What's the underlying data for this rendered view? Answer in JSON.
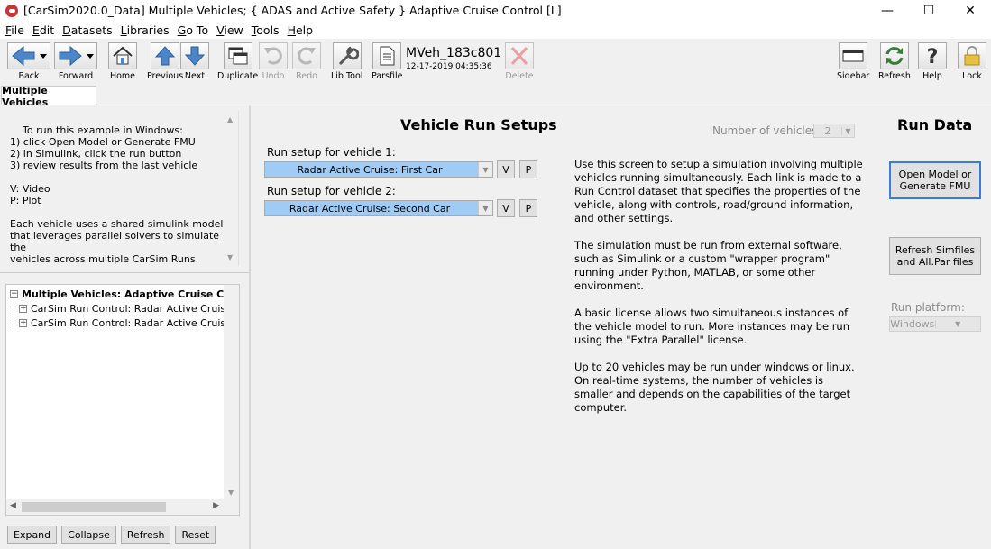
{
  "window": {
    "title": "[CarSim2020.0_Data] Multiple Vehicles; { ADAS and Active Safety } Adaptive Cruise Control [L]",
    "minimize": "—",
    "maximize": "☐",
    "close": "✕"
  },
  "menu": [
    {
      "key": "F",
      "rest": "ile"
    },
    {
      "key": "E",
      "rest": "dit"
    },
    {
      "key": "D",
      "rest": "atasets"
    },
    {
      "key": "L",
      "rest": "ibraries"
    },
    {
      "key": "G",
      "rest": "o To"
    },
    {
      "key": "V",
      "rest": "iew"
    },
    {
      "key": "T",
      "rest": "ools"
    },
    {
      "key": "H",
      "rest": "elp"
    }
  ],
  "toolbar": {
    "back": "Back",
    "forward": "Forward",
    "home": "Home",
    "previous": "Previous",
    "next": "Next",
    "duplicate": "Duplicate",
    "undo": "Undo",
    "redo": "Redo",
    "lib_tool": "Lib Tool",
    "parsfile": "Parsfile",
    "dataset_name": "MVeh_183c801",
    "dataset_date": "12-17-2019 04:35:36",
    "delete": "Delete",
    "sidebar": "Sidebar",
    "refresh": "Refresh",
    "help": "Help",
    "lock": "Lock"
  },
  "tab": {
    "label": "Multiple Vehicles"
  },
  "notes": "To run this example in Windows:\n1) click Open Model or Generate FMU\n2) in Simulink, click the run button\n3) review results from the last vehicle\n\nV: Video\nP: Plot\n\nEach vehicle uses a shared simulink model\nthat leverages parallel solvers to simulate the\nvehicles across multiple CarSim Runs.",
  "tree": {
    "root": "Multiple Vehicles: Adaptive Cruise Control",
    "children": [
      "CarSim Run Control: Radar Active Cruise: First Car",
      "CarSim Run Control: Radar Active Cruise: Second Car"
    ]
  },
  "left_buttons": {
    "expand": "Expand",
    "collapse": "Collapse",
    "refresh": "Refresh",
    "reset": "Reset"
  },
  "setups": {
    "heading": "Vehicle Run Setups",
    "num_vehicles_label": "Number of vehicles:",
    "num_vehicles_value": "2",
    "vehicle1_label": "Run setup for vehicle 1:",
    "vehicle1_value": "Radar Active Cruise: First Car",
    "vehicle2_label": "Run setup for vehicle 2:",
    "vehicle2_value": "Radar Active Cruise: Second Car",
    "v_btn": "V",
    "p_btn": "P"
  },
  "description": [
    "Use this screen to setup a simulation involving multiple vehicles running simultaneously. Each link is made to a Run Control dataset that specifies the properties of the vehicle, along with controls, road/ground information, and other settings.",
    "The simulation must be run from external software, such as Simulink or a custom \"wrapper program\" running under Python, MATLAB, or some other environment.",
    "A basic license allows two simultaneous instances of the vehicle model to run. More instances may be run using the \"Extra Parallel\" license.",
    "Up to 20 vehicles may be run under windows or linux. On real-time systems, the number of vehicles is smaller and depends on the capabilities of the target computer."
  ],
  "run_data": {
    "heading": "Run Data",
    "open_model_line1": "Open Model or",
    "open_model_line2": "Generate FMU",
    "refresh_line1": "Refresh Simfiles",
    "refresh_line2": "and All.Par files",
    "platform_label": "Run platform:",
    "platform_value": "Windows"
  }
}
